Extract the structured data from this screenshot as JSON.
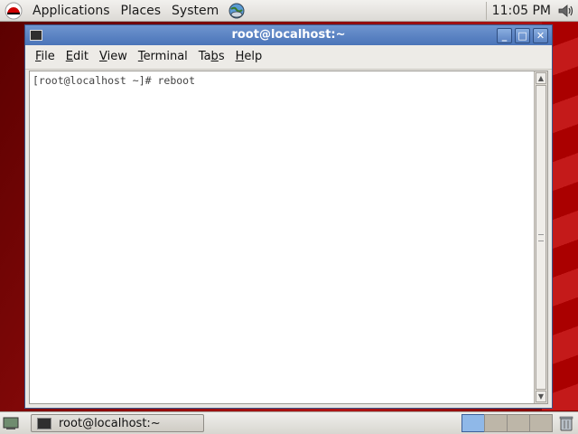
{
  "top_panel": {
    "menus": [
      "Applications",
      "Places",
      "System"
    ],
    "clock": "11:05 PM",
    "icons": [
      "redhat-logo-icon",
      "network-globe-icon",
      "volume-icon"
    ]
  },
  "window": {
    "title": "root@localhost:~",
    "menu": [
      {
        "mnemonic": "F",
        "rest": "ile"
      },
      {
        "mnemonic": "E",
        "rest": "dit"
      },
      {
        "mnemonic": "V",
        "rest": "iew"
      },
      {
        "mnemonic": "T",
        "rest": "erminal"
      },
      {
        "pre": "Ta",
        "mnemonic": "b",
        "rest": "s"
      },
      {
        "mnemonic": "H",
        "rest": "elp"
      }
    ],
    "buttons": {
      "minimize": "_",
      "maximize": "□",
      "close": "✕"
    },
    "terminal_line": "[root@localhost ~]# reboot"
  },
  "bottom_panel": {
    "task_label": "root@localhost:~",
    "workspaces": 4,
    "active_workspace": 1
  },
  "colors": {
    "titlebar": "#4a74b8",
    "desktop": "#8c0a0a",
    "workspace_active": "#8fb8e8"
  }
}
